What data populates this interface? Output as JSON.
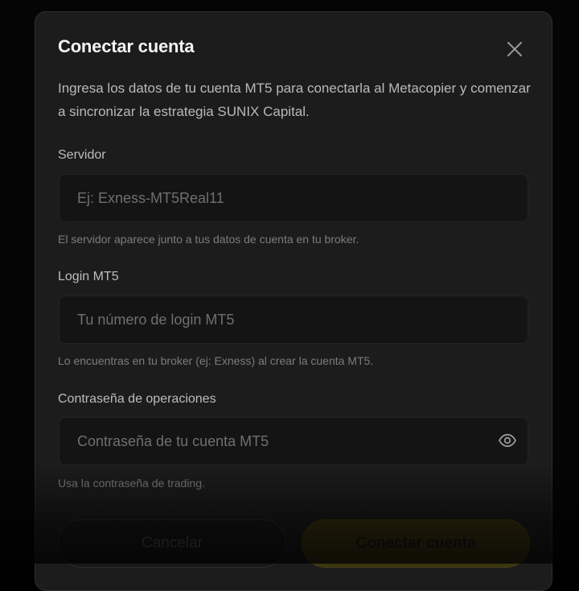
{
  "modal": {
    "title": "Conectar cuenta",
    "description": "Ingresa los datos de tu cuenta MT5 para conectarla al Metacopier y comenzar a sincronizar la estrategia SUNIX Capital.",
    "close_icon": "close-icon"
  },
  "fields": {
    "server": {
      "label": "Servidor",
      "value": "",
      "placeholder": "Ej: Exness-MT5Real11",
      "help": "El servidor aparece junto a tus datos de cuenta en tu broker."
    },
    "login": {
      "label": "Login MT5",
      "value": "",
      "placeholder": "Tu número de login MT5",
      "help": "Lo encuentras en tu broker (ej: Exness) al crear la cuenta MT5."
    },
    "password": {
      "label": "Contraseña de operaciones",
      "value": "",
      "placeholder": "Contraseña de tu cuenta MT5",
      "help": "Usa la contraseña de trading.",
      "toggle_icon": "eye-icon"
    }
  },
  "actions": {
    "cancel_label": "Cancelar",
    "connect_label": "Conectar cuenta"
  },
  "colors": {
    "background": "#000000",
    "modal_background": "#1c1c1c",
    "input_background": "#141414",
    "accent": "#f0d21e"
  }
}
